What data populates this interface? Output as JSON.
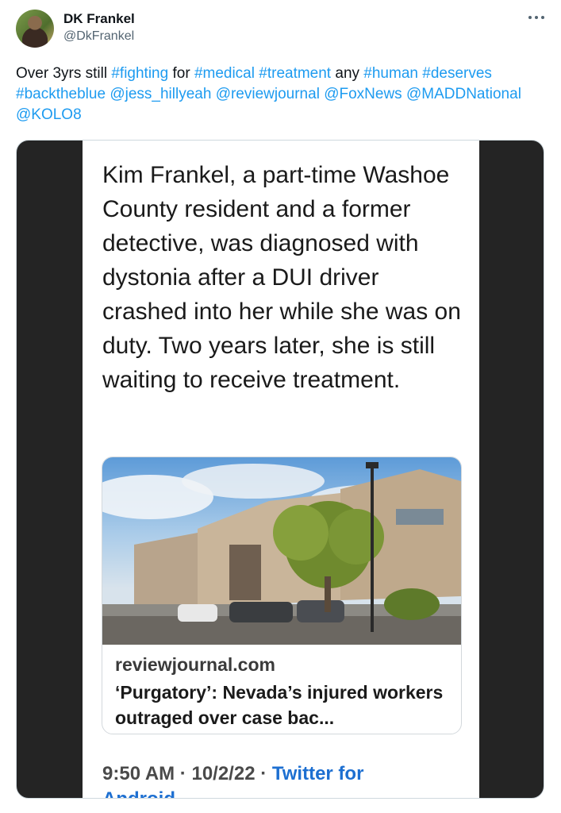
{
  "author": {
    "name": "DK Frankel",
    "handle": "@DkFrankel"
  },
  "menu_icon": "more-horizontal-icon",
  "tweet": {
    "segments": [
      {
        "text": "Over 3yrs still ",
        "type": "text"
      },
      {
        "text": "#fighting",
        "type": "tag"
      },
      {
        "text": " for ",
        "type": "text"
      },
      {
        "text": "#medical",
        "type": "tag"
      },
      {
        "text": " ",
        "type": "text"
      },
      {
        "text": "#treatment",
        "type": "tag"
      },
      {
        "text": " any ",
        "type": "text"
      },
      {
        "text": "#human",
        "type": "tag"
      },
      {
        "text": " ",
        "type": "text"
      },
      {
        "text": "#deserves",
        "type": "tag"
      },
      {
        "text": " ",
        "type": "text"
      },
      {
        "text": "#backtheblue",
        "type": "tag"
      },
      {
        "text": " ",
        "type": "text"
      },
      {
        "text": "@jess_hillyeah",
        "type": "tag"
      },
      {
        "text": " ",
        "type": "text"
      },
      {
        "text": "@reviewjournal",
        "type": "tag"
      },
      {
        "text": " ",
        "type": "text"
      },
      {
        "text": "@FoxNews",
        "type": "tag"
      },
      {
        "text": " ",
        "type": "text"
      },
      {
        "text": "@MADDNational",
        "type": "tag"
      },
      {
        "text": " ",
        "type": "text"
      },
      {
        "text": "@KOLO8",
        "type": "tag"
      }
    ]
  },
  "screenshot": {
    "body": "Kim Frankel, a part-time Washoe County resident and a former detective, was diagnosed with dystonia after a DUI driver crashed into her while she was on duty. Two years later, she is still waiting to receive treatment.",
    "card": {
      "domain": "reviewjournal.com",
      "title": "‘Purgatory’: Nevada’s injured workers outraged over case bac..."
    },
    "time": "9:50 AM",
    "date": "10/2/22",
    "source": "Twitter for",
    "source_cont": "Android",
    "sep": " · "
  },
  "colors": {
    "link": "#1d9bf0",
    "media_bg": "#242424"
  }
}
